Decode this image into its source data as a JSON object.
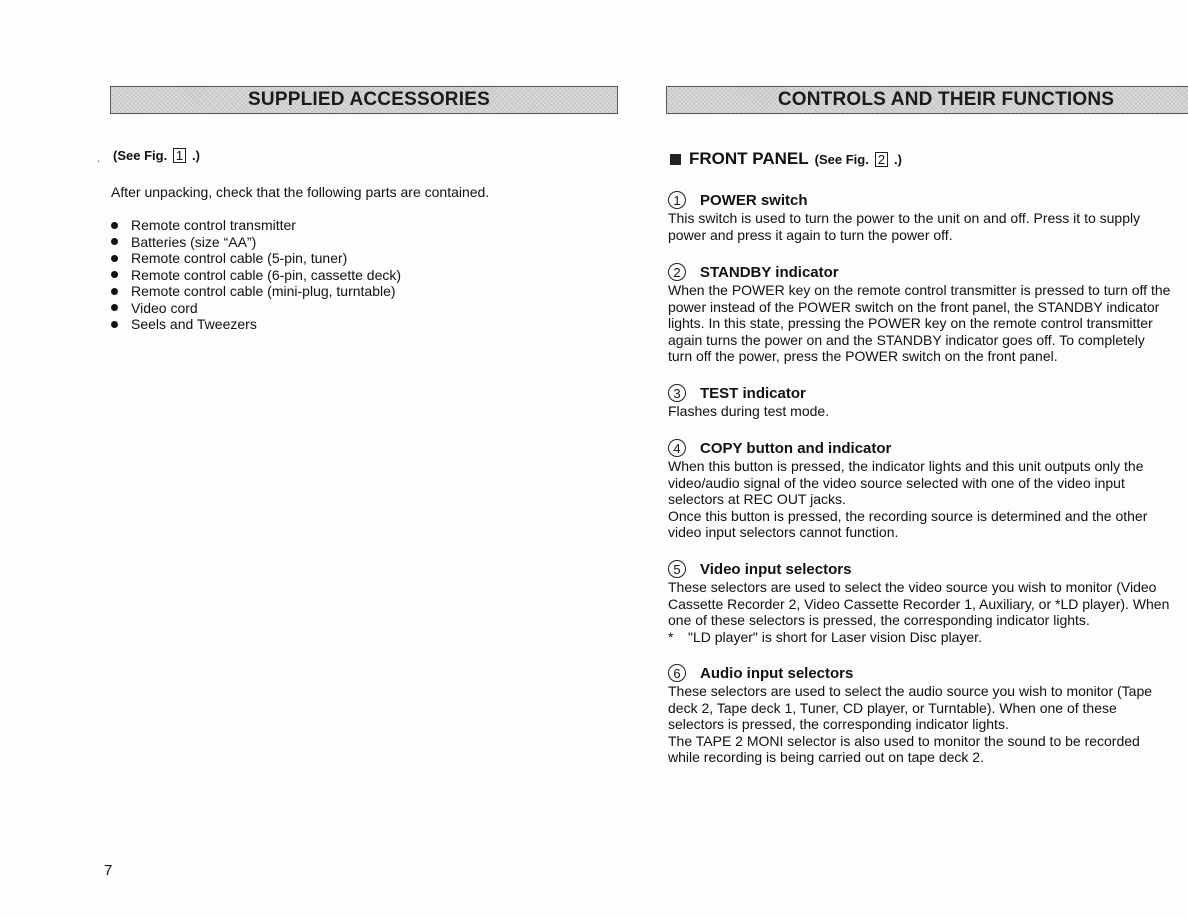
{
  "left_page": {
    "banner_title": "SUPPLIED ACCESSORIES",
    "see_fig_prefix": "(See Fig.",
    "see_fig_number": "1",
    "see_fig_suffix": ".)",
    "intro": "After unpacking, check that the following parts are contained.",
    "items": [
      "Remote control transmitter",
      "Batteries (size “AA”)",
      "Remote control cable (5-pin, tuner)",
      "Remote control cable (6-pin, cassette deck)",
      "Remote control cable (mini-plug, turntable)",
      "Video cord",
      "Seels and Tweezers"
    ],
    "page_number": "7"
  },
  "right_page": {
    "banner_title": "CONTROLS AND THEIR FUNCTIONS",
    "section_title": "FRONT PANEL",
    "see_fig_prefix": "(See Fig.",
    "see_fig_number": "2",
    "see_fig_suffix": ".)",
    "controls": [
      {
        "number": "1",
        "title": "POWER switch",
        "lines": [
          "This switch is used to turn the power to the unit on and off.  Press it to supply",
          "power and press it again to turn the power off."
        ]
      },
      {
        "number": "2",
        "title": "STANDBY indicator",
        "lines": [
          "When the POWER key on the remote control transmitter is pressed to turn off the",
          "power instead of the POWER switch on the front panel, the STANDBY indicator",
          "lights.  In this state, pressing the POWER key on the remote control transmitter",
          "again turns the power on and the STANDBY indicator goes off.  To completely",
          "turn off the power, press the POWER switch on the front panel."
        ]
      },
      {
        "number": "3",
        "title": "TEST indicator",
        "lines": [
          "Flashes during test mode."
        ]
      },
      {
        "number": "4",
        "title": "COPY button and indicator",
        "lines": [
          "When this button is pressed, the indicator lights and this unit outputs only the",
          "video/audio signal of the video source selected with one of the video input",
          "selectors at REC OUT jacks.",
          "Once this button is pressed, the recording source is determined and the other",
          "video input selectors cannot function."
        ]
      },
      {
        "number": "5",
        "title": "Video input selectors",
        "lines": [
          "These selectors are used to select the video source you wish to monitor (Video",
          "Cassette Recorder 2, Video Cassette Recorder 1, Auxiliary, or *LD player).  When",
          "one of these selectors is pressed, the corresponding indicator lights."
        ],
        "note_mark": "*",
        "note": "\"LD player\" is short for Laser vision Disc player."
      },
      {
        "number": "6",
        "title": "Audio input selectors",
        "lines": [
          "These selectors are used to select the audio source you wish to monitor (Tape",
          "deck 2, Tape deck 1, Tuner, CD player, or Turntable).  When one of these",
          "selectors is pressed, the corresponding indicator lights.",
          "The TAPE 2 MONI selector is also used to monitor the sound to be recorded",
          "while recording is being carried out on tape deck 2."
        ]
      }
    ]
  }
}
